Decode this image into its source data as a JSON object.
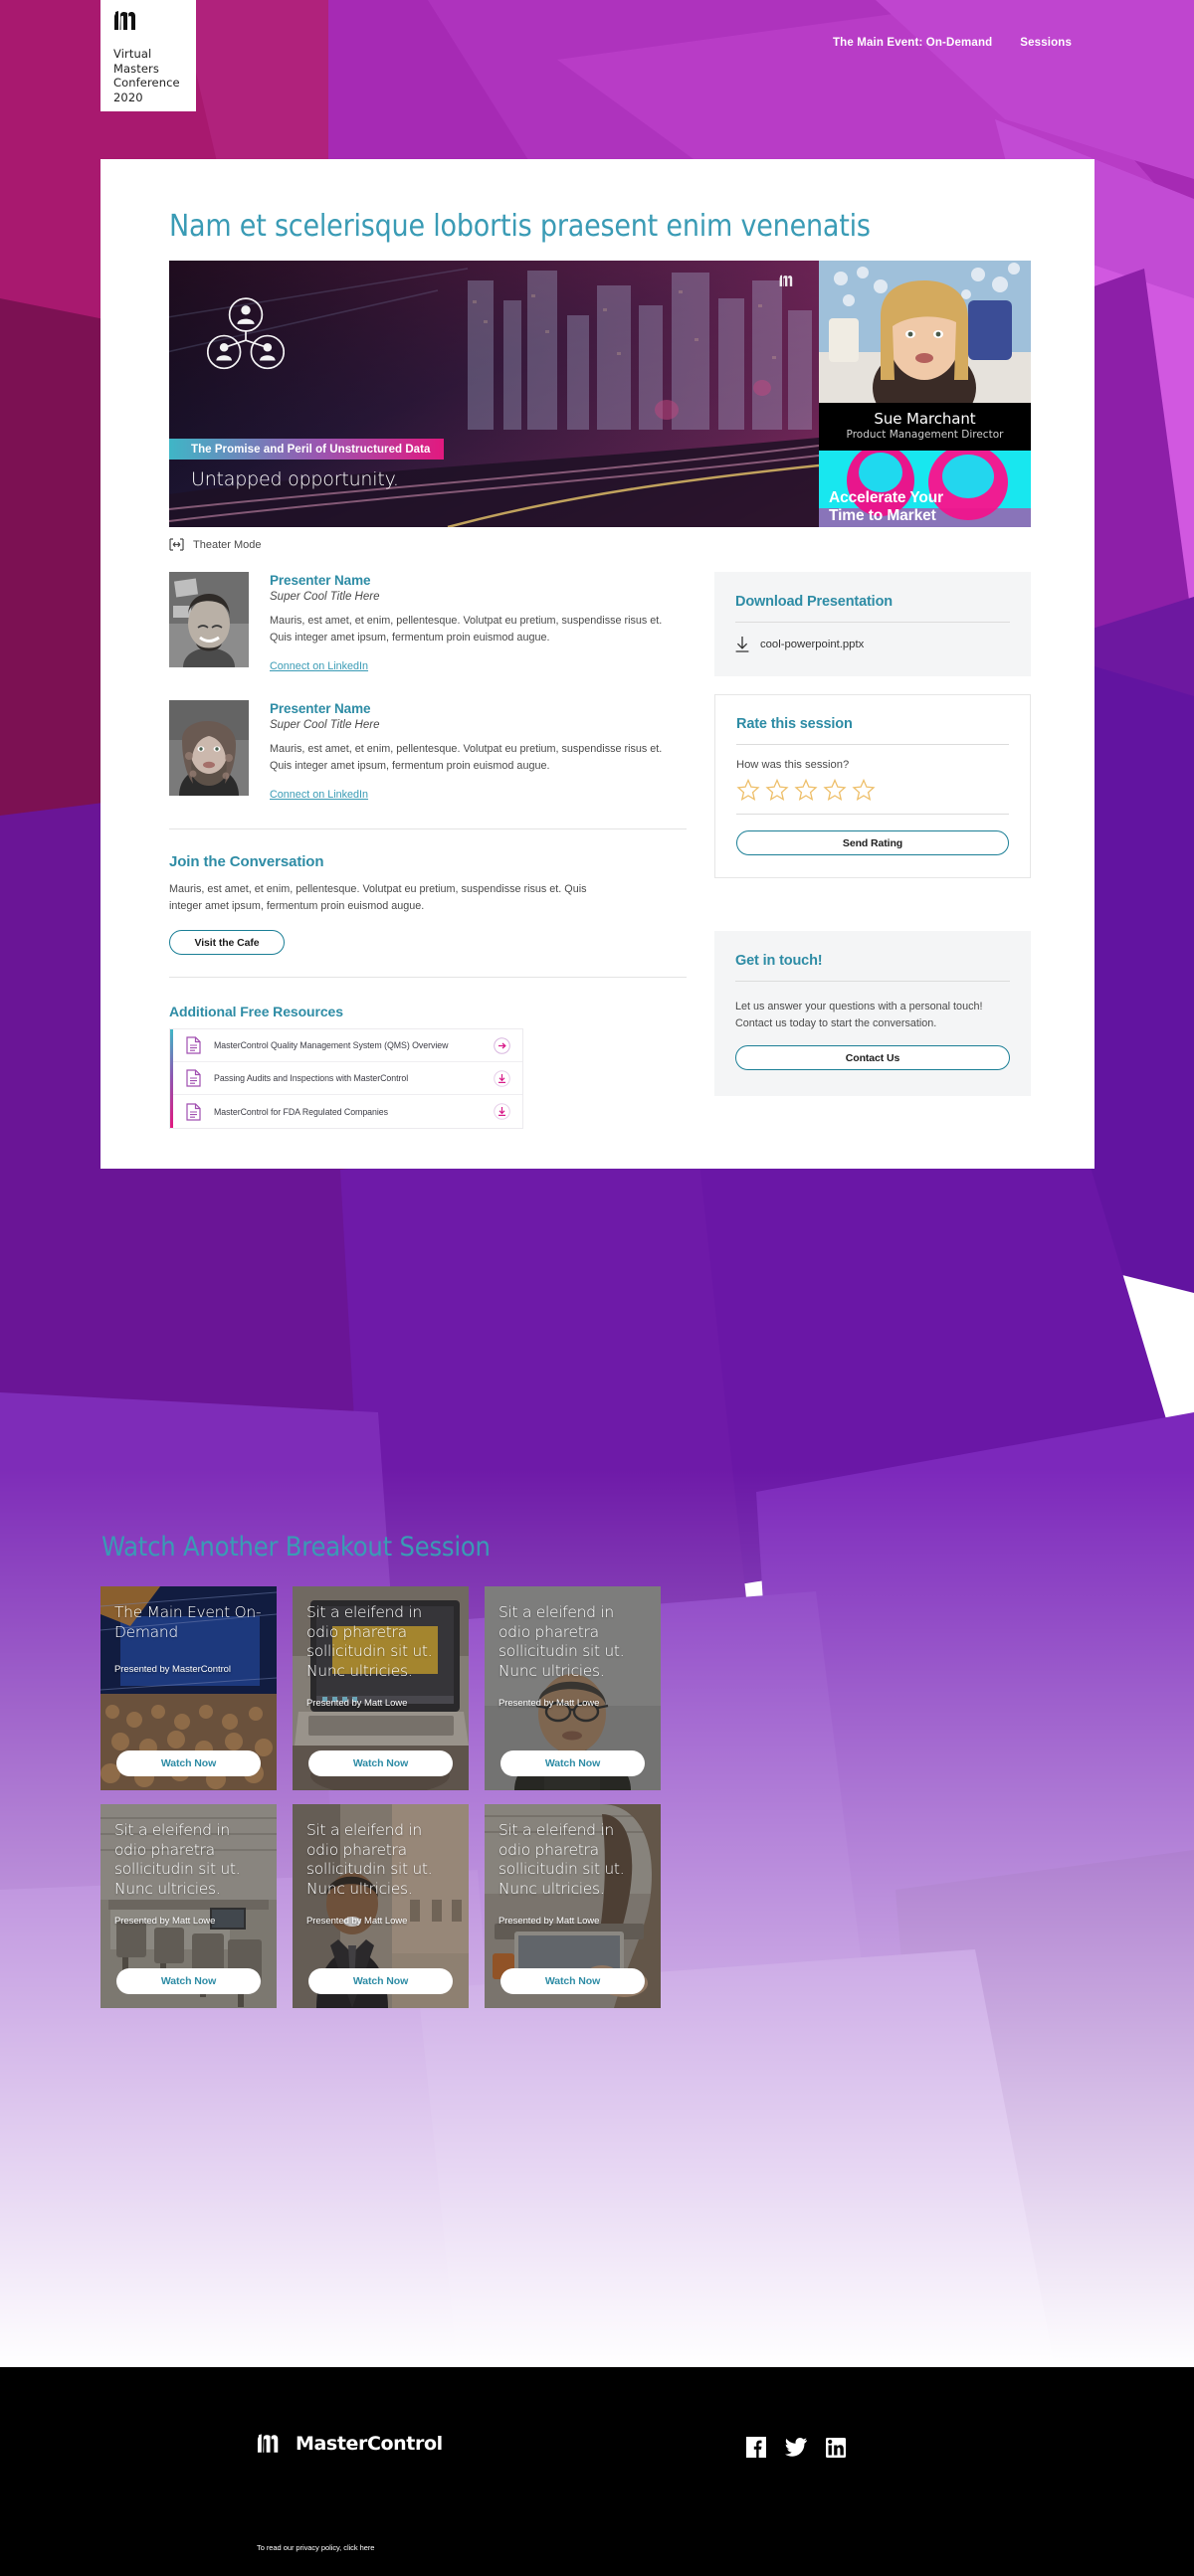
{
  "header": {
    "logo_mark": "mastercontrol-m-logo",
    "logo_lines": [
      "Virtual",
      "Masters",
      "Conference",
      "2020"
    ],
    "nav": [
      {
        "label": "The Main Event: On-Demand"
      },
      {
        "label": "Sessions"
      }
    ]
  },
  "page": {
    "title": "Nam et scelerisque lobortis praesent enim venenatis"
  },
  "video": {
    "tag": "The Promise and Peril of Unstructured Data",
    "subtitle": "Untapped opportunity.",
    "watermark": "mastercontrol-m-logo",
    "speaker": {
      "name": "Sue Marchant",
      "role": "Product Management Director"
    },
    "promo": {
      "line1": "Accelerate Your",
      "line2": "Time to Market"
    },
    "theater_mode": "Theater Mode"
  },
  "presenters": [
    {
      "name": "Presenter Name",
      "title": "Super Cool Title Here",
      "bio": "Mauris, est amet, et enim, pellentesque. Volutpat eu pretium, suspendisse risus et. Quis integer amet ipsum, fermentum proin euismod augue.",
      "link": "Connect on LinkedIn"
    },
    {
      "name": "Presenter Name",
      "title": "Super Cool Title Here",
      "bio": "Mauris, est amet, et enim, pellentesque. Volutpat eu pretium, suspendisse risus et. Quis integer amet ipsum, fermentum proin euismod augue.",
      "link": "Connect on LinkedIn"
    }
  ],
  "conversation": {
    "heading": "Join the Conversation",
    "body": "Mauris, est amet, et enim, pellentesque. Volutpat eu pretium, suspendisse risus et. Quis integer amet ipsum, fermentum proin euismod augue.",
    "button": "Visit the Cafe"
  },
  "resources": {
    "heading": "Additional Free Resources",
    "items": [
      {
        "label": "MasterControl Quality Management System (QMS) Overview",
        "action_icon": "arrow-right-icon"
      },
      {
        "label": "Passing Audits and Inspections with MasterControl",
        "action_icon": "download-icon"
      },
      {
        "label": "MasterControl for FDA Regulated Companies",
        "action_icon": "download-icon"
      }
    ]
  },
  "download_card": {
    "heading": "Download Presentation",
    "file": "cool-powerpoint.pptx",
    "icon": "download-icon"
  },
  "rating_card": {
    "heading": "Rate this session",
    "question": "How was this session?",
    "stars": 5,
    "selected": 0,
    "button": "Send Rating",
    "star_color": "#eebf6a"
  },
  "contact_card": {
    "heading": "Get in touch!",
    "body": "Let us answer your questions with a personal touch! Contact us today to start the conversation.",
    "button": "Contact Us"
  },
  "breakout": {
    "heading": "Watch Another Breakout Session",
    "cards": [
      {
        "title": "The Main Event On-Demand",
        "presenter": "Presented by MasterControl",
        "button": "Watch Now",
        "thumb": "conference-crowd"
      },
      {
        "title": "Sit a eleifend in odio pharetra sollicitudin sit ut. Nunc ultricies.",
        "presenter": "Presented by Matt Lowe",
        "button": "Watch Now",
        "thumb": "laptop-desk"
      },
      {
        "title": "Sit a eleifend in odio pharetra sollicitudin sit ut. Nunc ultricies.",
        "presenter": "Presented by Matt Lowe",
        "button": "Watch Now",
        "thumb": "man-glasses"
      },
      {
        "title": "Sit a eleifend in odio pharetra sollicitudin sit ut. Nunc ultricies.",
        "presenter": "Presented by Matt Lowe",
        "button": "Watch Now",
        "thumb": "office-chairs"
      },
      {
        "title": "Sit a eleifend in odio pharetra sollicitudin sit ut. Nunc ultricies.",
        "presenter": "Presented by Matt Lowe",
        "button": "Watch Now",
        "thumb": "businessman-alley"
      },
      {
        "title": "Sit a eleifend in odio pharetra sollicitudin sit ut. Nunc ultricies.",
        "presenter": "Presented by Matt Lowe",
        "button": "Watch Now",
        "thumb": "woman-laptop"
      }
    ]
  },
  "footer": {
    "brand": "MasterControl",
    "logo_mark": "mastercontrol-m-logo",
    "privacy": "To read our privacy policy, click here",
    "social": [
      {
        "name": "facebook-icon"
      },
      {
        "name": "twitter-icon"
      },
      {
        "name": "linkedin-icon"
      }
    ]
  },
  "colors": {
    "teal": "#2e8ca5",
    "teal_light": "#3a9bb5",
    "magenta": "#e2197f",
    "purple": "#8e57b2",
    "star": "#eebf6a"
  }
}
